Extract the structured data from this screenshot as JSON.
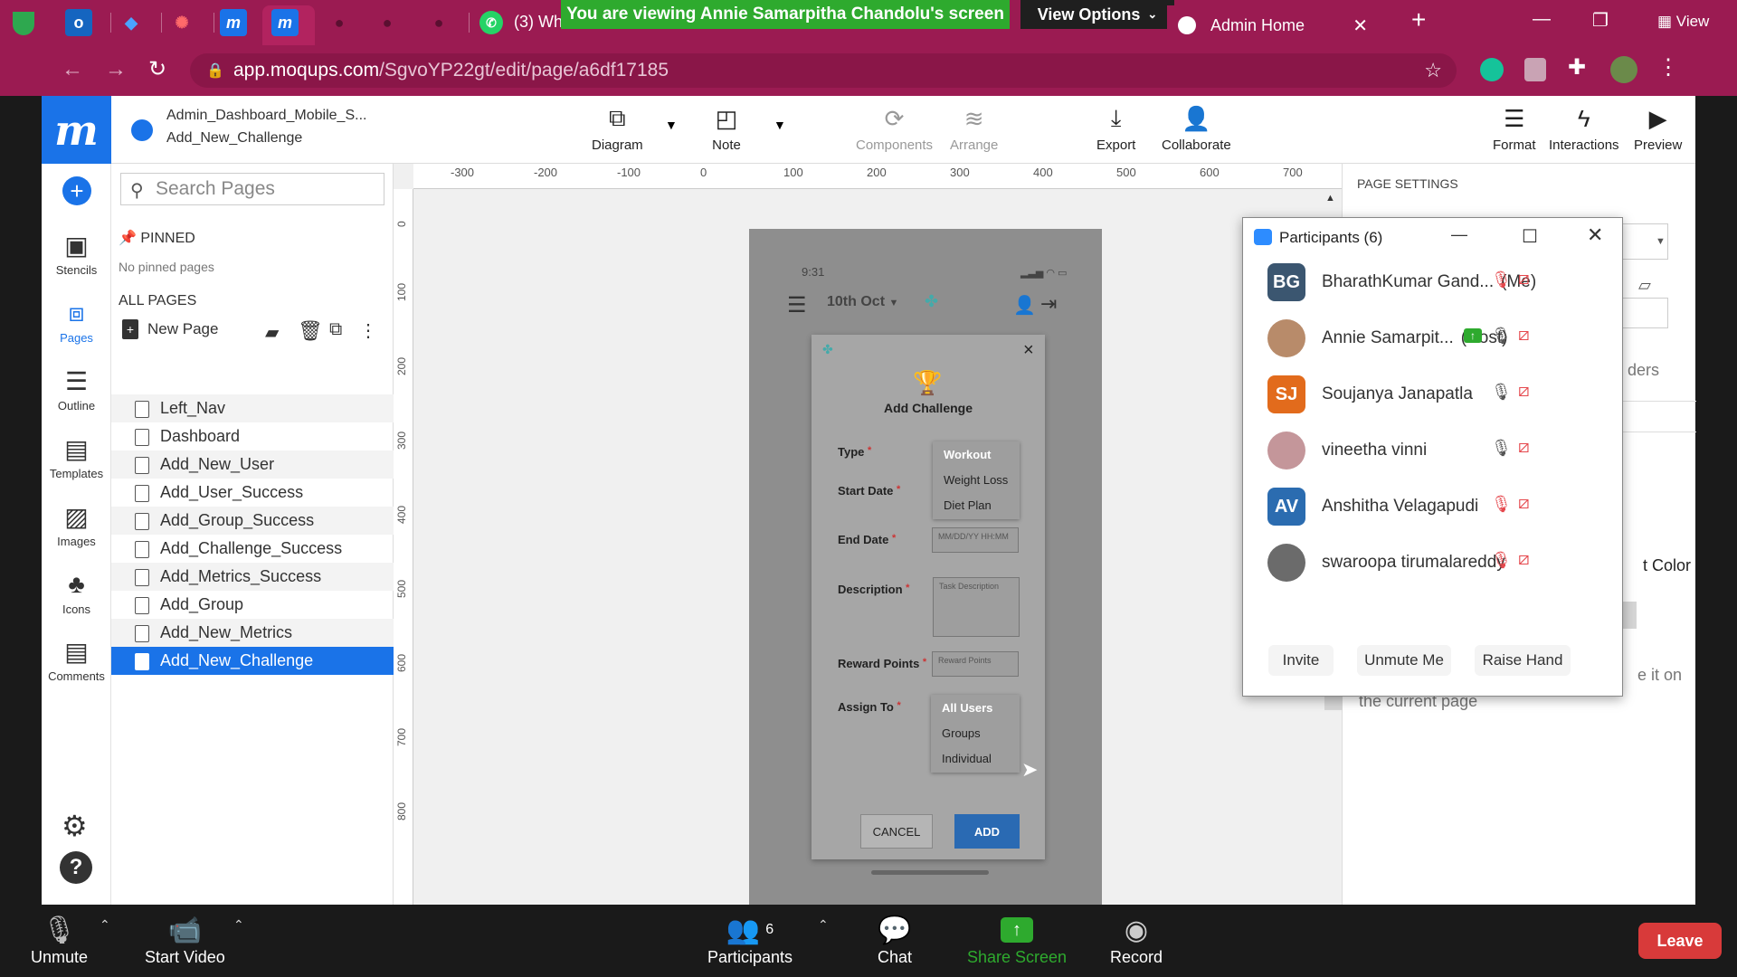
{
  "browser": {
    "whatsapp_tab": "(3) Wh",
    "active_tab_title": "Admin Home",
    "url_host": "app.moqups.com",
    "url_path": "/SgvoYP22gt/edit/page/a6df17185",
    "view_label": "View"
  },
  "zoom_banner": {
    "viewing_text": "You are viewing Annie Samarpitha Chandolu's screen",
    "view_options": "View Options"
  },
  "app": {
    "project_name": "Admin_Dashboard_Mobile_S...",
    "page_name": "Add_New_Challenge",
    "toolbar": {
      "diagram": "Diagram",
      "note": "Note",
      "components": "Components",
      "arrange": "Arrange",
      "export": "Export",
      "collaborate": "Collaborate",
      "format": "Format",
      "interactions": "Interactions",
      "preview": "Preview"
    },
    "rail": {
      "stencils": "Stencils",
      "pages": "Pages",
      "outline": "Outline",
      "templates": "Templates",
      "images": "Images",
      "icons": "Icons",
      "comments": "Comments"
    },
    "pages_panel": {
      "search_placeholder": "Search Pages",
      "pinned_heading": "PINNED",
      "no_pinned": "No pinned pages",
      "all_pages_heading": "ALL PAGES",
      "new_page": "New Page",
      "pages": [
        "Left_Nav",
        "Dashboard",
        "Add_New_User",
        "Add_User_Success",
        "Add_Group_Success",
        "Add_Challenge_Success",
        "Add_Metrics_Success",
        "Add_Group",
        "Add_New_Metrics",
        "Add_New_Challenge"
      ],
      "selected_page": "Add_New_Challenge"
    },
    "ruler_top": [
      "-300",
      "-200",
      "-100",
      "0",
      "100",
      "200",
      "300",
      "400",
      "500",
      "600",
      "700"
    ],
    "ruler_left": [
      "0",
      "100",
      "200",
      "300",
      "400",
      "500",
      "600",
      "700",
      "800"
    ],
    "right_panel": {
      "heading": "PAGE SETTINGS",
      "partial_1": "ders",
      "partial_2": "t Color",
      "partial_3": "e it on",
      "partial_4": "the current page"
    }
  },
  "mockup": {
    "status_time": "9:31",
    "date_label": "10th Oct",
    "modal_title": "Add Challenge",
    "labels": {
      "type": "Type",
      "start_date": "Start Date",
      "end_date": "End Date",
      "description": "Description",
      "reward_points": "Reward Points",
      "assign_to": "Assign To"
    },
    "type_options": [
      "Workout",
      "Weight Loss",
      "Diet Plan"
    ],
    "end_date_placeholder": "MM/DD/YY HH:MM",
    "description_placeholder": "Task Description",
    "reward_placeholder": "Reward Points",
    "assign_options": [
      "All Users",
      "Groups",
      "Individual"
    ],
    "cancel": "CANCEL",
    "add": "ADD",
    "close": "×",
    "required": "*"
  },
  "participants": {
    "title": "Participants (6)",
    "list": [
      {
        "initials": "BG",
        "name": "BharathKumar Gand...",
        "tag": "(Me)",
        "color": "#3b5670"
      },
      {
        "initials": "",
        "name": "Annie Samarpit...",
        "tag": "(Host)",
        "color": "#b88b6a"
      },
      {
        "initials": "SJ",
        "name": "Soujanya Janapatla",
        "tag": "",
        "color": "#e26b1c"
      },
      {
        "initials": "",
        "name": "vineetha vinni",
        "tag": "",
        "color": "#c4969a"
      },
      {
        "initials": "AV",
        "name": "Anshitha Velagapudi",
        "tag": "",
        "color": "#2b6cb0"
      },
      {
        "initials": "",
        "name": "swaroopa tirumalareddy",
        "tag": "",
        "color": "#6b6b6b"
      }
    ],
    "invite": "Invite",
    "unmute_me": "Unmute Me",
    "raise_hand": "Raise Hand"
  },
  "zoom_bar": {
    "unmute": "Unmute",
    "start_video": "Start Video",
    "participants": "Participants",
    "participant_count": "6",
    "chat": "Chat",
    "share_screen": "Share Screen",
    "record": "Record",
    "leave": "Leave"
  },
  "colors": {
    "chrome_bar": "#9b1b52",
    "moqups_blue": "#1a73e8",
    "zoom_green": "#2eaa2e",
    "leave_red": "#d83a3a"
  }
}
